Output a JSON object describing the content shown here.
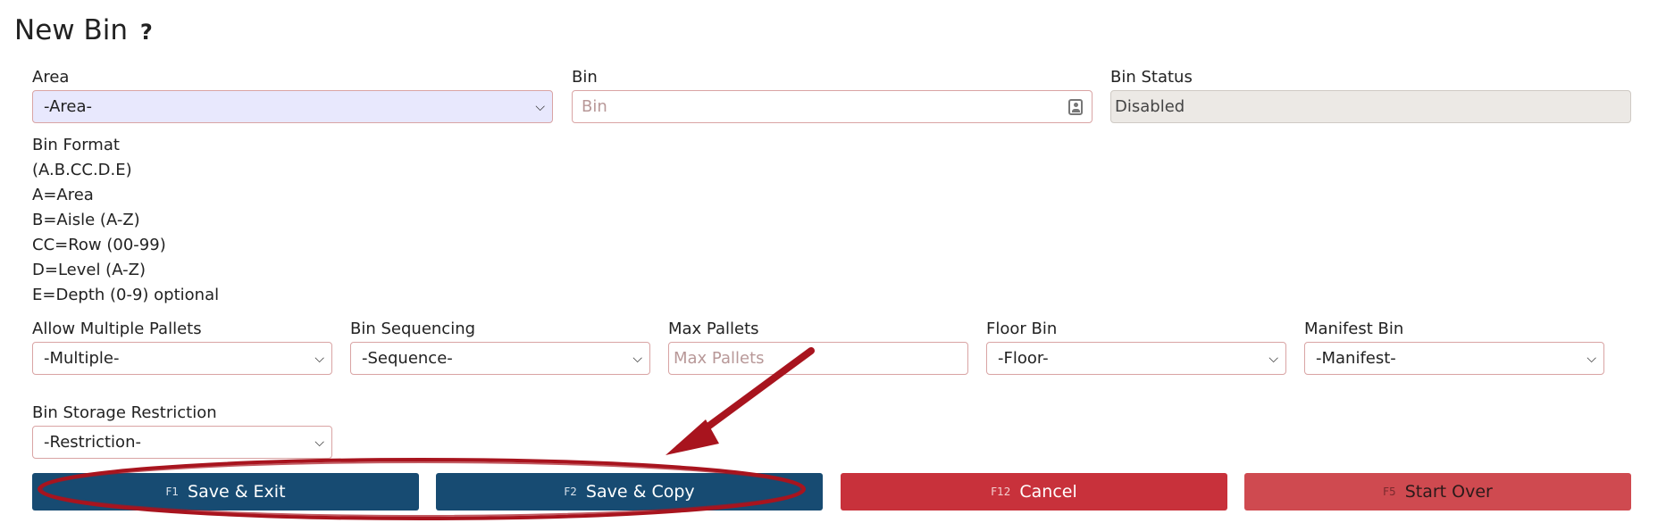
{
  "page": {
    "title": "New Bin",
    "help": "?"
  },
  "area": {
    "label": "Area",
    "value": "-Area-"
  },
  "bin": {
    "label": "Bin",
    "placeholder": "Bin"
  },
  "bin_status": {
    "label": "Bin Status",
    "value": "Disabled"
  },
  "bin_format": {
    "lines": [
      "Bin Format",
      "(A.B.CC.D.E)",
      "A=Area",
      "B=Aisle (A-Z)",
      "CC=Row (00-99)",
      "D=Level (A-Z)",
      "E=Depth (0-9) optional"
    ]
  },
  "allow_multiple": {
    "label": "Allow Multiple Pallets",
    "value": "-Multiple-"
  },
  "sequencing": {
    "label": "Bin Sequencing",
    "value": "-Sequence-"
  },
  "max_pallets": {
    "label": "Max Pallets",
    "placeholder": "Max Pallets"
  },
  "floor_bin": {
    "label": "Floor Bin",
    "value": "-Floor-"
  },
  "manifest_bin": {
    "label": "Manifest Bin",
    "value": "-Manifest-"
  },
  "restriction": {
    "label": "Bin Storage Restriction",
    "value": "-Restriction-"
  },
  "buttons": {
    "save_exit": {
      "key": "F1",
      "label": "Save & Exit"
    },
    "save_copy": {
      "key": "F2",
      "label": "Save & Copy"
    },
    "cancel": {
      "key": "F12",
      "label": "Cancel"
    },
    "start_over": {
      "key": "F5",
      "label": "Start Over"
    }
  },
  "colors": {
    "primary": "#174b72",
    "danger": "#c8313b",
    "annotation": "#a8141e"
  },
  "icons": {
    "select_caret": "chevron-down-icon",
    "bin_field": "contact-card-icon"
  }
}
